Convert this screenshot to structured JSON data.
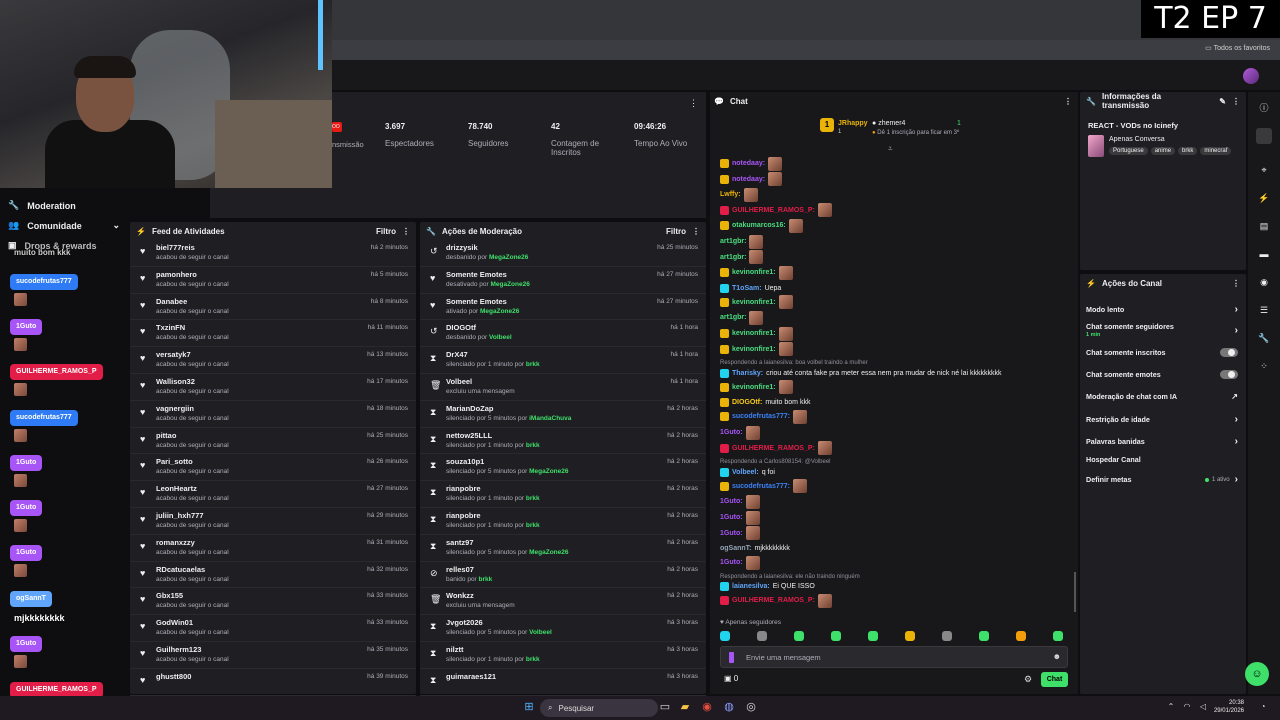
{
  "overlay": {
    "episode": "T2 EP 7"
  },
  "browser": {
    "favorites": "Todos os favoritos"
  },
  "leftnav": {
    "items": [
      {
        "label": "Moderation",
        "icon": "wrench-icon"
      },
      {
        "label": "Comunidade",
        "icon": "people-icon"
      },
      {
        "label": "Drops & rewards",
        "icon": "gift-icon"
      }
    ]
  },
  "overlay_chat": {
    "top_text": "muito bom kkk",
    "names": [
      {
        "name": "sucodefrutas777",
        "color": "#2f7bf5"
      },
      {
        "name": "1Guto",
        "color": "#a855f7"
      },
      {
        "name": "GUILHERME_RAMOS_P",
        "color": "#e11d48"
      },
      {
        "name": "sucodefrutas777",
        "color": "#2f7bf5"
      },
      {
        "name": "1Guto",
        "color": "#a855f7"
      },
      {
        "name": "1Guto",
        "color": "#a855f7"
      },
      {
        "name": "1Guto",
        "color": "#a855f7"
      },
      {
        "name": "ogSannT",
        "color": "#60a5fa"
      },
      {
        "name": "1Guto",
        "color": "#a855f7"
      },
      {
        "name": "GUILHERME_RAMOS_P",
        "color": "#e11d48"
      }
    ],
    "text_msg": "mjkkkkkkkk"
  },
  "stats": {
    "badge": "OO",
    "transmission": "nsmissão",
    "viewers_value": "3.697",
    "viewers_label": "Espectadores",
    "followers_value": "78.740",
    "followers_label": "Seguidores",
    "subs_value": "42",
    "subs_label": "Contagem de Inscritos",
    "time_value": "09:46:26",
    "time_label": "Tempo Ao Vivo"
  },
  "activity": {
    "title": "Feed de Atividades",
    "filter": "Filtro",
    "rows": [
      {
        "name": "biel777reis",
        "sub": "acabou de seguir o canal",
        "time": "há 2 minutos"
      },
      {
        "name": "pamonhero",
        "sub": "acabou de seguir o canal",
        "time": "há 5 minutos"
      },
      {
        "name": "Danabee",
        "sub": "acabou de seguir o canal",
        "time": "há 8 minutos"
      },
      {
        "name": "TxzinFN",
        "sub": "acabou de seguir o canal",
        "time": "há 11 minutos"
      },
      {
        "name": "versatyk7",
        "sub": "acabou de seguir o canal",
        "time": "há 13 minutos"
      },
      {
        "name": "Wallison32",
        "sub": "acabou de seguir o canal",
        "time": "há 17 minutos"
      },
      {
        "name": "vagnergiin",
        "sub": "acabou de seguir o canal",
        "time": "há 18 minutos"
      },
      {
        "name": "pittao",
        "sub": "acabou de seguir o canal",
        "time": "há 25 minutos"
      },
      {
        "name": "Pari_sotto",
        "sub": "acabou de seguir o canal",
        "time": "há 26 minutos"
      },
      {
        "name": "LeonHeartz",
        "sub": "acabou de seguir o canal",
        "time": "há 27 minutos"
      },
      {
        "name": "juliin_hxh777",
        "sub": "acabou de seguir o canal",
        "time": "há 29 minutos"
      },
      {
        "name": "romanxzzy",
        "sub": "acabou de seguir o canal",
        "time": "há 31 minutos"
      },
      {
        "name": "RDcatucaelas",
        "sub": "acabou de seguir o canal",
        "time": "há 32 minutos"
      },
      {
        "name": "Gbx155",
        "sub": "acabou de seguir o canal",
        "time": "há 33 minutos"
      },
      {
        "name": "GodWin01",
        "sub": "acabou de seguir o canal",
        "time": "há 33 minutos"
      },
      {
        "name": "Guilherm123",
        "sub": "acabou de seguir o canal",
        "time": "há 35 minutos"
      },
      {
        "name": "ghustt800",
        "sub": "",
        "time": "há 39 minutos"
      }
    ]
  },
  "moderation": {
    "title": "Ações de Moderação",
    "filter": "Filtro",
    "rows": [
      {
        "name": "drizzysik",
        "pre": "desbanido por",
        "by": "MegaZone26",
        "time": "há 25 minutos",
        "icon": "undo-icon"
      },
      {
        "name": "Somente Emotes",
        "pre": "desativado por",
        "by": "MegaZone26",
        "time": "há 27 minutos",
        "icon": "heart-icon"
      },
      {
        "name": "Somente Emotes",
        "pre": "ativado por",
        "by": "MegaZone26",
        "time": "há 27 minutos",
        "icon": "heart-icon"
      },
      {
        "name": "DIOGOtf",
        "pre": "desbanido por",
        "by": "Volbeel",
        "time": "há 1 hora",
        "icon": "undo-icon"
      },
      {
        "name": "DrX47",
        "pre": "silenciado por 1 minuto por",
        "by": "brkk",
        "time": "há 1 hora",
        "icon": "hourglass-icon"
      },
      {
        "name": "Volbeel",
        "pre": "excluiu uma mensagem",
        "by": "",
        "time": "há 1 hora",
        "icon": "trash-icon"
      },
      {
        "name": "MarianDoZap",
        "pre": "silenciado por 5 minutos por",
        "by": "iMandaChuva",
        "time": "há 2 horas",
        "icon": "hourglass-icon"
      },
      {
        "name": "nettow25LLL",
        "pre": "silenciado por 1 minuto por",
        "by": "brkk",
        "time": "há 2 horas",
        "icon": "hourglass-icon"
      },
      {
        "name": "souza10p1",
        "pre": "silenciado por 5 minutos por",
        "by": "MegaZone26",
        "time": "há 2 horas",
        "icon": "hourglass-icon"
      },
      {
        "name": "rianpobre",
        "pre": "silenciado por 1 minuto por",
        "by": "brkk",
        "time": "há 2 horas",
        "icon": "hourglass-icon"
      },
      {
        "name": "rianpobre",
        "pre": "silenciado por 1 minuto por",
        "by": "brkk",
        "time": "há 2 horas",
        "icon": "hourglass-icon"
      },
      {
        "name": "santz97",
        "pre": "silenciado por 5 minutos por",
        "by": "MegaZone26",
        "time": "há 2 horas",
        "icon": "hourglass-icon"
      },
      {
        "name": "relles07",
        "pre": "banido por",
        "by": "brkk",
        "time": "há 2 horas",
        "icon": "ban-icon"
      },
      {
        "name": "Wonkzz",
        "pre": "excluiu uma mensagem",
        "by": "",
        "time": "há 2 horas",
        "icon": "trash-icon"
      },
      {
        "name": "Jvgot2026",
        "pre": "silenciado por 5 minutos por",
        "by": "Volbeel",
        "time": "há 3 horas",
        "icon": "hourglass-icon"
      },
      {
        "name": "nilztt",
        "pre": "silenciado por 1 minuto por",
        "by": "brkk",
        "time": "há 3 horas",
        "icon": "hourglass-icon"
      },
      {
        "name": "guimaraes121",
        "pre": "",
        "by": "",
        "time": "há 3 horas",
        "icon": "hourglass-icon"
      }
    ]
  },
  "chat": {
    "title": "Chat",
    "top_user": "JRhappy",
    "top_user_count": "1",
    "gift_user": "zhemer4",
    "gift_count": "1",
    "gift_text": "Dê 1 inscrição para ficar em 3º",
    "lines": [
      {
        "type": "msg",
        "user": "notedaay:",
        "color": "#a855f7",
        "msg": "",
        "emotes": 1,
        "badge": "#eab308"
      },
      {
        "type": "msg",
        "user": "notedaay:",
        "color": "#a855f7",
        "msg": "",
        "emotes": 1,
        "badge": "#eab308"
      },
      {
        "type": "msg",
        "user": "Lwffy:",
        "color": "#eab308",
        "msg": "",
        "emotes": 1,
        "badge": ""
      },
      {
        "type": "msg",
        "user": "GUILHERME_RAMOS_P:",
        "color": "#e11d48",
        "msg": "",
        "emotes": 1,
        "badge": "#e11d48"
      },
      {
        "type": "msg",
        "user": "otakumarcos16:",
        "color": "#4ade80",
        "msg": "",
        "emotes": 1,
        "badge": "#eab308"
      },
      {
        "type": "msg",
        "user": "art1gbr:",
        "color": "#4ade80",
        "msg": "",
        "emotes": 1,
        "badge": ""
      },
      {
        "type": "msg",
        "user": "art1gbr:",
        "color": "#4ade80",
        "msg": "",
        "emotes": 1,
        "badge": ""
      },
      {
        "type": "msg",
        "user": "kevinonfire1:",
        "color": "#4ade80",
        "msg": "",
        "emotes": 1,
        "badge": "#eab308"
      },
      {
        "type": "msg",
        "user": "T1oSam:",
        "color": "#60a5fa",
        "msg": "Uepa",
        "emotes": 0,
        "badge": "#22d3ee"
      },
      {
        "type": "msg",
        "user": "kevinonfire1:",
        "color": "#4ade80",
        "msg": "",
        "emotes": 1,
        "badge": "#eab308"
      },
      {
        "type": "msg",
        "user": "art1gbr:",
        "color": "#4ade80",
        "msg": "",
        "emotes": 1,
        "badge": ""
      },
      {
        "type": "msg",
        "user": "kevinonfire1:",
        "color": "#4ade80",
        "msg": "",
        "emotes": 1,
        "badge": "#eab308"
      },
      {
        "type": "msg",
        "user": "kevinonfire1:",
        "color": "#4ade80",
        "msg": "",
        "emotes": 1,
        "badge": "#eab308"
      },
      {
        "type": "reply",
        "text": "Respondendo a laianesilva: boa volbel traindo a mulher"
      },
      {
        "type": "msg",
        "user": "Tharisky:",
        "color": "#60a5fa",
        "msg": "criou até conta fake pra meter essa nem pra mudar de nick né lai kkkkkkkkk",
        "emotes": 0,
        "badge": "#22d3ee"
      },
      {
        "type": "msg",
        "user": "kevinonfire1:",
        "color": "#4ade80",
        "msg": "",
        "emotes": 1,
        "badge": "#eab308"
      },
      {
        "type": "msg",
        "user": "DIOGOtf:",
        "color": "#facc15",
        "msg": "muito bom kkk",
        "emotes": 0,
        "badge": "#eab308"
      },
      {
        "type": "msg",
        "user": "sucodefrutas777:",
        "color": "#3b82f6",
        "msg": "",
        "emotes": 1,
        "badge": "#eab308"
      },
      {
        "type": "msg",
        "user": "1Guto:",
        "color": "#a855f7",
        "msg": "",
        "emotes": 1,
        "badge": ""
      },
      {
        "type": "msg",
        "user": "GUILHERME_RAMOS_P:",
        "color": "#e11d48",
        "msg": "",
        "emotes": 1,
        "badge": "#e11d48"
      },
      {
        "type": "reply",
        "text": "Respondendo a Carlos808154: @Volbeel"
      },
      {
        "type": "msg",
        "user": "Volbeel:",
        "color": "#60a5fa",
        "msg": "q foi",
        "emotes": 0,
        "badge": "#22d3ee"
      },
      {
        "type": "msg",
        "user": "sucodefrutas777:",
        "color": "#3b82f6",
        "msg": "",
        "emotes": 1,
        "badge": "#eab308"
      },
      {
        "type": "msg",
        "user": "1Guto:",
        "color": "#a855f7",
        "msg": "",
        "emotes": 1,
        "badge": ""
      },
      {
        "type": "msg",
        "user": "1Guto:",
        "color": "#a855f7",
        "msg": "",
        "emotes": 1,
        "badge": ""
      },
      {
        "type": "msg",
        "user": "1Guto:",
        "color": "#a855f7",
        "msg": "",
        "emotes": 1,
        "badge": ""
      },
      {
        "type": "msg",
        "user": "ogSannT:",
        "color": "#94a3b8",
        "msg": "mjkkkkkkkk",
        "emotes": 0,
        "badge": ""
      },
      {
        "type": "msg",
        "user": "1Guto:",
        "color": "#a855f7",
        "msg": "",
        "emotes": 1,
        "badge": ""
      },
      {
        "type": "reply",
        "text": "Respondendo a laianesilva: ele não traindo ninguém"
      },
      {
        "type": "msg",
        "user": "laianesilva:",
        "color": "#60a5fa",
        "msg": "Ei QUE ISSO",
        "emotes": 0,
        "badge": "#22d3ee"
      },
      {
        "type": "msg",
        "user": "GUILHERME_RAMOS_P:",
        "color": "#e11d48",
        "msg": "",
        "emotes": 1,
        "badge": "#e11d48"
      }
    ],
    "followers_only": "Apenas seguidores",
    "input_placeholder": "Envie uma mensagem",
    "points": "0",
    "send_label": "Chat"
  },
  "info": {
    "title": "Informações da transmissão",
    "stream_title": "REACT - VODs no Icinefy",
    "category": "Apenas Conversa",
    "tags": [
      "Portuguese",
      "anime",
      "brkk",
      "minecraf"
    ]
  },
  "actions": {
    "title": "Ações do Canal",
    "items": [
      {
        "label": "Modo lento",
        "control": "chevron",
        "sub": ""
      },
      {
        "label": "Chat somente seguidores",
        "control": "chevron",
        "sub": "1 min"
      },
      {
        "label": "Chat somente inscritos",
        "control": "toggle",
        "sub": ""
      },
      {
        "label": "Chat somente emotes",
        "control": "toggle",
        "sub": ""
      },
      {
        "label": "Moderação de chat com IA",
        "control": "external",
        "sub": ""
      },
      {
        "label": "Restrição de idade",
        "control": "chevron",
        "sub": ""
      },
      {
        "label": "Palavras banidas",
        "control": "chevron",
        "sub": ""
      },
      {
        "label": "Hospedar Canal",
        "control": "none",
        "sub": ""
      },
      {
        "label": "Definir metas",
        "control": "chevron",
        "sub": "1 ativo"
      }
    ]
  },
  "taskbar": {
    "search": "Pesquisar",
    "time": "20:38",
    "date": "29/01/2026"
  }
}
